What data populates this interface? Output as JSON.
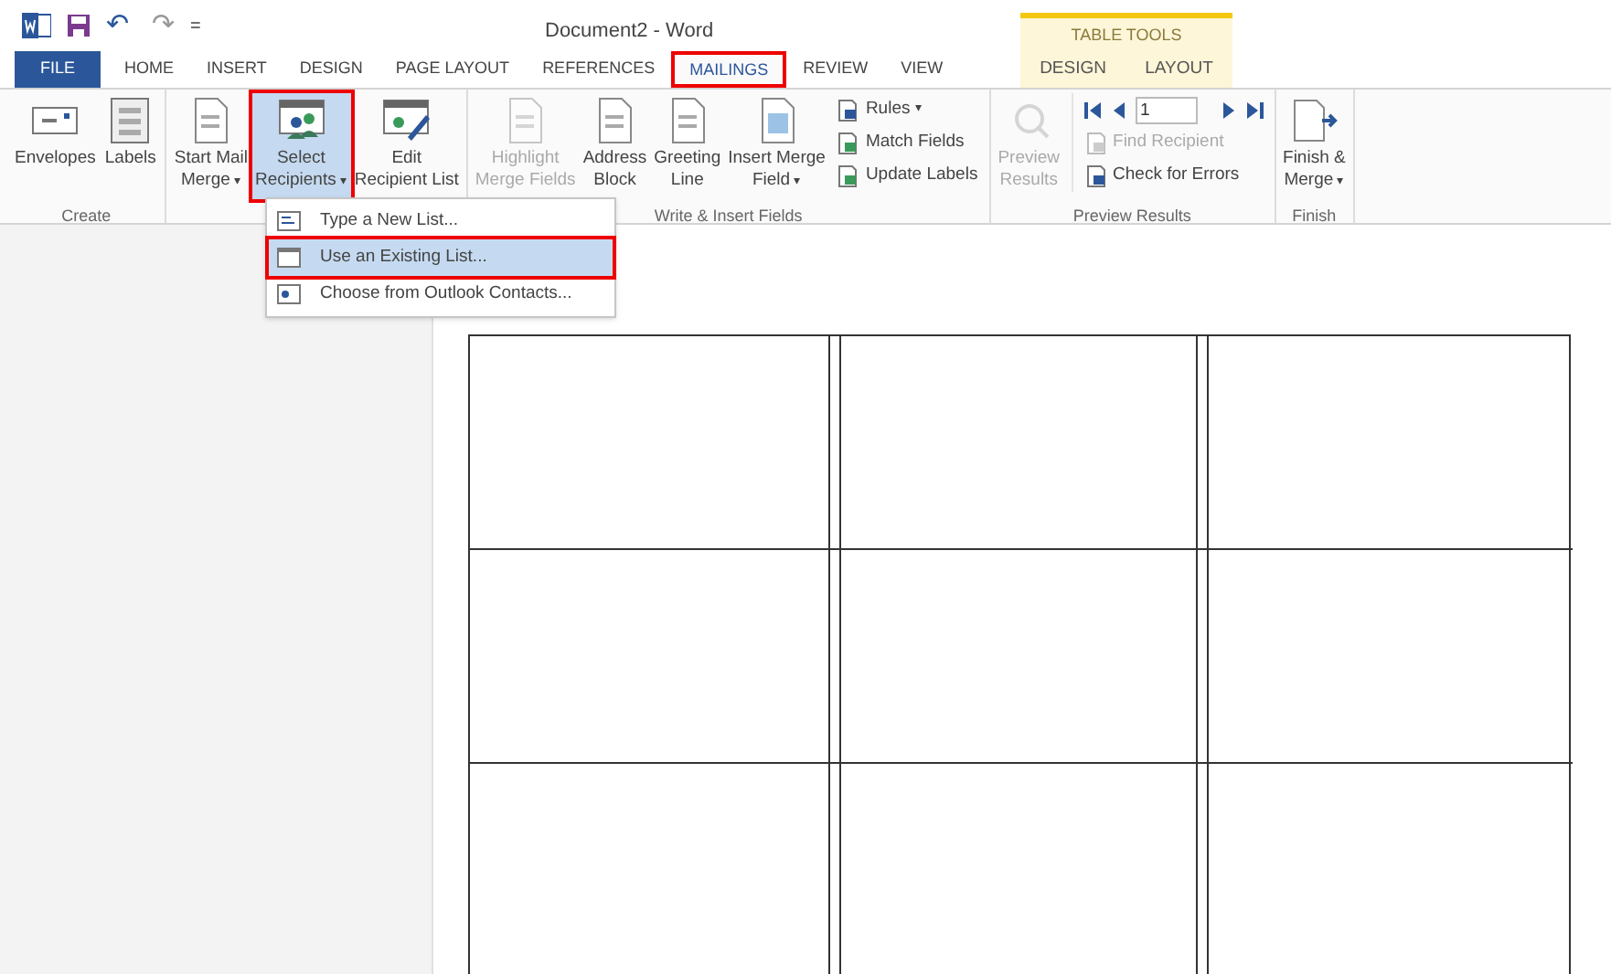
{
  "window": {
    "title": "Document2 - Word"
  },
  "quick_access": {
    "undo": "↶",
    "redo": "↷",
    "customize": "="
  },
  "tabs": [
    {
      "label": "FILE",
      "kind": "file",
      "selected": false,
      "highlighted": false
    },
    {
      "label": "HOME",
      "kind": "tab",
      "selected": false,
      "highlighted": false
    },
    {
      "label": "INSERT",
      "kind": "tab",
      "selected": false,
      "highlighted": false
    },
    {
      "label": "DESIGN",
      "kind": "tab",
      "selected": false,
      "highlighted": false
    },
    {
      "label": "PAGE LAYOUT",
      "kind": "tab",
      "selected": false,
      "highlighted": false
    },
    {
      "label": "REFERENCES",
      "kind": "tab",
      "selected": false,
      "highlighted": false
    },
    {
      "label": "MAILINGS",
      "kind": "tab",
      "selected": true,
      "highlighted": true
    },
    {
      "label": "REVIEW",
      "kind": "tab",
      "selected": false,
      "highlighted": false
    },
    {
      "label": "VIEW",
      "kind": "tab",
      "selected": false,
      "highlighted": false
    }
  ],
  "contextual_tabs": {
    "title": "TABLE TOOLS",
    "tabs": [
      {
        "label": "DESIGN",
        "selected": false
      },
      {
        "label": "LAYOUT",
        "selected": false
      }
    ]
  },
  "ribbon_groups": [
    {
      "label": "Create",
      "items": [
        {
          "kind": "large",
          "lines": [
            "Envelopes"
          ],
          "disabled": false,
          "selected": false,
          "highlighted": false
        },
        {
          "kind": "large",
          "lines": [
            "Labels"
          ],
          "disabled": false,
          "selected": false,
          "highlighted": false
        }
      ]
    },
    {
      "items": [
        {
          "kind": "large",
          "lines": [
            "Start Mail",
            "Merge"
          ],
          "dropdown": "▾",
          "disabled": false,
          "selected": false,
          "highlighted": false
        },
        {
          "kind": "large",
          "lines": [
            "Select",
            "Recipients"
          ],
          "dropdown": "▾",
          "disabled": false,
          "selected": true,
          "highlighted": true
        },
        {
          "kind": "large",
          "lines": [
            "Edit",
            "Recipient List"
          ],
          "disabled": false,
          "selected": false,
          "highlighted": false
        }
      ]
    },
    {
      "label": "Write & Insert Fields",
      "items": [
        {
          "kind": "large",
          "lines": [
            "Highlight",
            "Merge Fields"
          ],
          "disabled": true,
          "selected": false,
          "highlighted": false
        },
        {
          "kind": "large",
          "lines": [
            "Address",
            "Block"
          ],
          "disabled": false,
          "selected": false,
          "highlighted": false
        },
        {
          "kind": "large",
          "lines": [
            "Greeting",
            "Line"
          ],
          "disabled": false,
          "selected": false,
          "highlighted": false
        },
        {
          "kind": "large",
          "lines": [
            "Insert Merge",
            "Field"
          ],
          "dropdown": "▾",
          "disabled": false,
          "selected": false,
          "highlighted": false
        },
        {
          "kind": "small_stack",
          "buttons": [
            {
              "label": "Rules",
              "dropdown": "▾",
              "disabled": false
            },
            {
              "label": "Match Fields",
              "disabled": false
            },
            {
              "label": "Update Labels",
              "disabled": false
            }
          ]
        }
      ]
    },
    {
      "label": "Preview Results",
      "items": [
        {
          "kind": "large",
          "lines": [
            "Preview",
            "Results"
          ],
          "disabled": true,
          "selected": false,
          "highlighted": false
        },
        {
          "kind": "navigator",
          "record": "1",
          "buttons": [
            {
              "label": "Find Recipient",
              "disabled": true
            },
            {
              "label": "Check for Errors",
              "disabled": false
            }
          ]
        }
      ]
    },
    {
      "label": "Finish",
      "items": [
        {
          "kind": "large",
          "lines": [
            "Finish &",
            "Merge"
          ],
          "dropdown": "▾",
          "disabled": false,
          "selected": false,
          "highlighted": false
        }
      ]
    }
  ],
  "dropdown_menu": [
    {
      "label": "Type a New List...",
      "selected": false,
      "highlighted": false
    },
    {
      "label": "Use an Existing List...",
      "selected": true,
      "highlighted": true
    },
    {
      "label": "Choose from Outlook Contacts...",
      "selected": false,
      "highlighted": false
    }
  ]
}
